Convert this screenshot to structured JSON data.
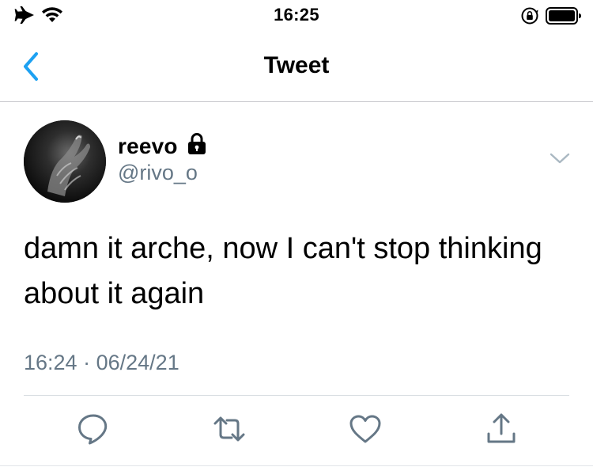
{
  "status_bar": {
    "time": "16:25",
    "left_icons": [
      "airplane-icon",
      "wifi-icon"
    ],
    "right_icons": [
      "rotation-lock-icon",
      "battery-icon"
    ]
  },
  "nav": {
    "title": "Tweet",
    "back_icon": "chevron-left-icon"
  },
  "tweet": {
    "display_name": "reevo",
    "protected_icon": "lock-icon",
    "handle": "@rivo_o",
    "text": "damn it arche, now I can't stop thinking about it again",
    "time": "16:24",
    "separator": "·",
    "date": "06/24/21"
  },
  "actions": [
    {
      "name": "reply",
      "icon": "reply-icon"
    },
    {
      "name": "retweet",
      "icon": "retweet-icon"
    },
    {
      "name": "like",
      "icon": "heart-icon"
    },
    {
      "name": "share",
      "icon": "share-icon"
    }
  ],
  "colors": {
    "accent": "#1DA1F2",
    "secondary_text": "#657786",
    "icon_gray": "#657786"
  }
}
